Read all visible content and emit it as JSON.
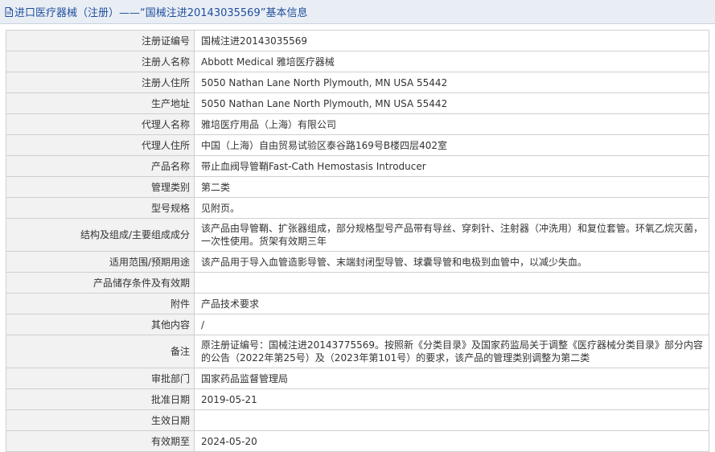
{
  "header": {
    "title": "进口医疗器械（注册）——“国械注进20143035569”基本信息",
    "icon": "document-icon",
    "title_color": "#1f4e9c"
  },
  "fields": [
    {
      "label": "注册证编号",
      "value": "国械注进20143035569"
    },
    {
      "label": "注册人名称",
      "value": "Abbott Medical 雅培医疗器械"
    },
    {
      "label": "注册人住所",
      "value": "5050 Nathan Lane North Plymouth, MN USA 55442"
    },
    {
      "label": "生产地址",
      "value": "5050 Nathan Lane North Plymouth, MN USA 55442"
    },
    {
      "label": "代理人名称",
      "value": "雅培医疗用品（上海）有限公司"
    },
    {
      "label": "代理人住所",
      "value": "中国（上海）自由贸易试验区泰谷路169号B楼四层402室"
    },
    {
      "label": "产品名称",
      "value": "带止血阀导管鞘Fast-Cath Hemostasis Introducer"
    },
    {
      "label": "管理类别",
      "value": "第二类"
    },
    {
      "label": "型号规格",
      "value": "见附页。"
    },
    {
      "label": "结构及组成/主要组成成分",
      "value": "该产品由导管鞘、扩张器组成，部分规格型号产品带有导丝、穿刺针、注射器（冲洗用）和复位套管。环氧乙烷灭菌，一次性使用。货架有效期三年"
    },
    {
      "label": "适用范围/预期用途",
      "value": "该产品用于导入血管造影导管、末端封闭型导管、球囊导管和电极到血管中，以减少失血。"
    },
    {
      "label": "产品储存条件及有效期",
      "value": ""
    },
    {
      "label": "附件",
      "value": "产品技术要求"
    },
    {
      "label": "其他内容",
      "value": "/"
    },
    {
      "label": "备注",
      "value": "原注册证编号：国械注进20143775569。按照新《分类目录》及国家药监局关于调整《医疗器械分类目录》部分内容的公告（2022年第25号）及（2023年第101号）的要求，该产品的管理类别调整为第二类"
    },
    {
      "label": "审批部门",
      "value": "国家药品监督管理局"
    },
    {
      "label": "批准日期",
      "value": "2019-05-21"
    },
    {
      "label": "生效日期",
      "value": ""
    },
    {
      "label": "有效期至",
      "value": "2024-05-20"
    }
  ]
}
